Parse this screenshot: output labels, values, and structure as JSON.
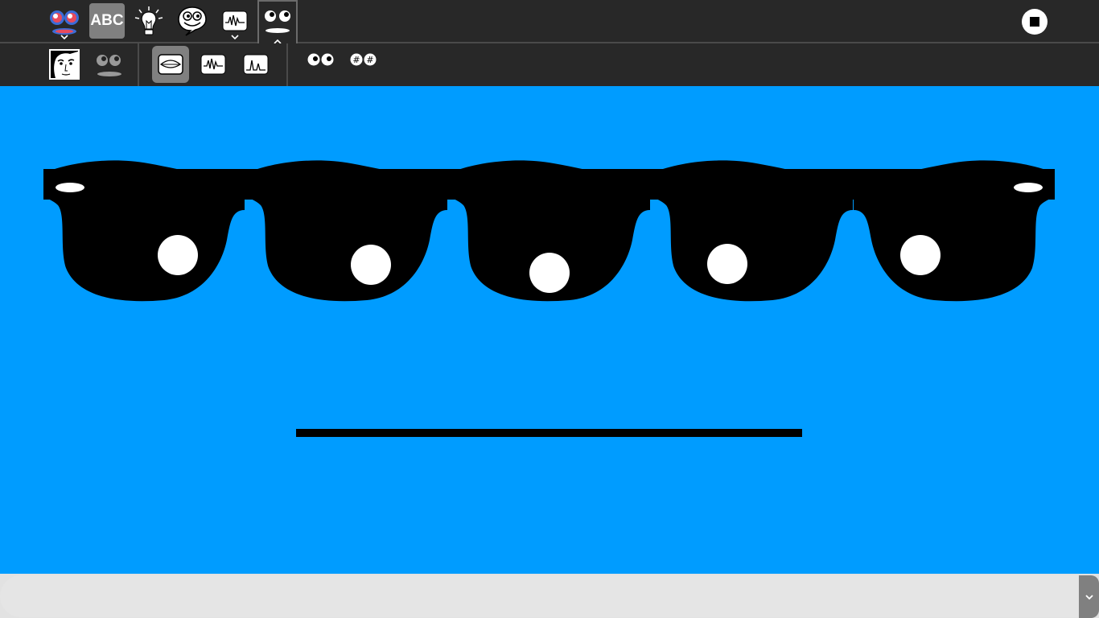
{
  "toolbar": {
    "activity_icon": "speak-activity-icon",
    "abc_label": "ABC",
    "tools": [
      "idea-icon",
      "chat-icon",
      "wave-icon",
      "face-icon"
    ],
    "stop_icon": "stop-icon"
  },
  "subtoolbar": {
    "items": [
      "face-photo-icon",
      "eyes-mouth-icon",
      "mouth-icon",
      "waveform-icon",
      "spectrum-icon",
      "eye-count-icon",
      "eye-hash-icon"
    ],
    "active_index": 2
  },
  "face": {
    "eye_count": 5,
    "lens_color": "#000000",
    "pupil_color": "#ffffff",
    "mouth_color": "#000000",
    "background": "#009cff"
  },
  "input": {
    "value": "",
    "placeholder": ""
  },
  "colors": {
    "toolbar_bg": "#282828",
    "button_active": "#808080",
    "canvas_bg": "#009cff",
    "bottom_bg": "#e2e2e2"
  }
}
